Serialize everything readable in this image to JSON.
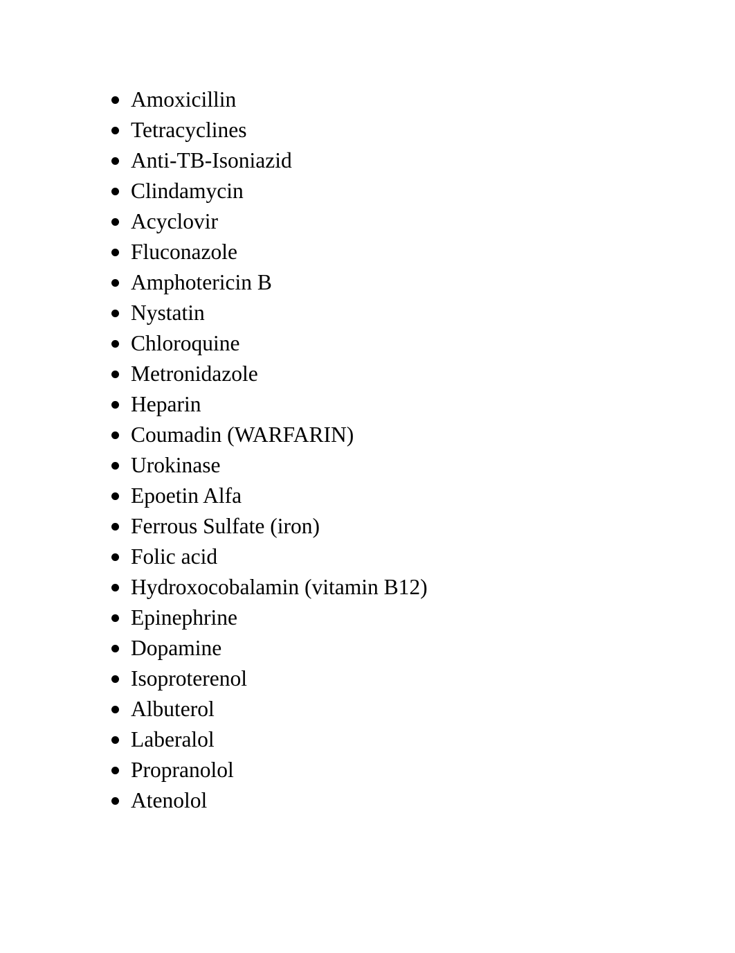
{
  "document": {
    "background_color": "#ffffff",
    "text_color": "#000000",
    "bullet_glyph": "filled-round-bullet",
    "list": {
      "items": [
        {
          "label": "Amoxicillin"
        },
        {
          "label": "Tetracyclines"
        },
        {
          "label": "Anti-TB-Isoniazid"
        },
        {
          "label": "Clindamycin"
        },
        {
          "label": "Acyclovir"
        },
        {
          "label": "Fluconazole"
        },
        {
          "label": "Amphotericin B"
        },
        {
          "label": "Nystatin"
        },
        {
          "label": "Chloroquine"
        },
        {
          "label": "Metronidazole"
        },
        {
          "label": "Heparin"
        },
        {
          "label": "Coumadin (WARFARIN)"
        },
        {
          "label": "Urokinase"
        },
        {
          "label": "Epoetin Alfa"
        },
        {
          "label": "Ferrous Sulfate (iron)"
        },
        {
          "label": "Folic acid"
        },
        {
          "label": "Hydroxocobalamin (vitamin B12)"
        },
        {
          "label": "Epinephrine"
        },
        {
          "label": "Dopamine"
        },
        {
          "label": "Isoproterenol"
        },
        {
          "label": "Albuterol"
        },
        {
          "label": "Laberalol"
        },
        {
          "label": "Propranolol"
        },
        {
          "label": "Atenolol"
        }
      ]
    }
  }
}
